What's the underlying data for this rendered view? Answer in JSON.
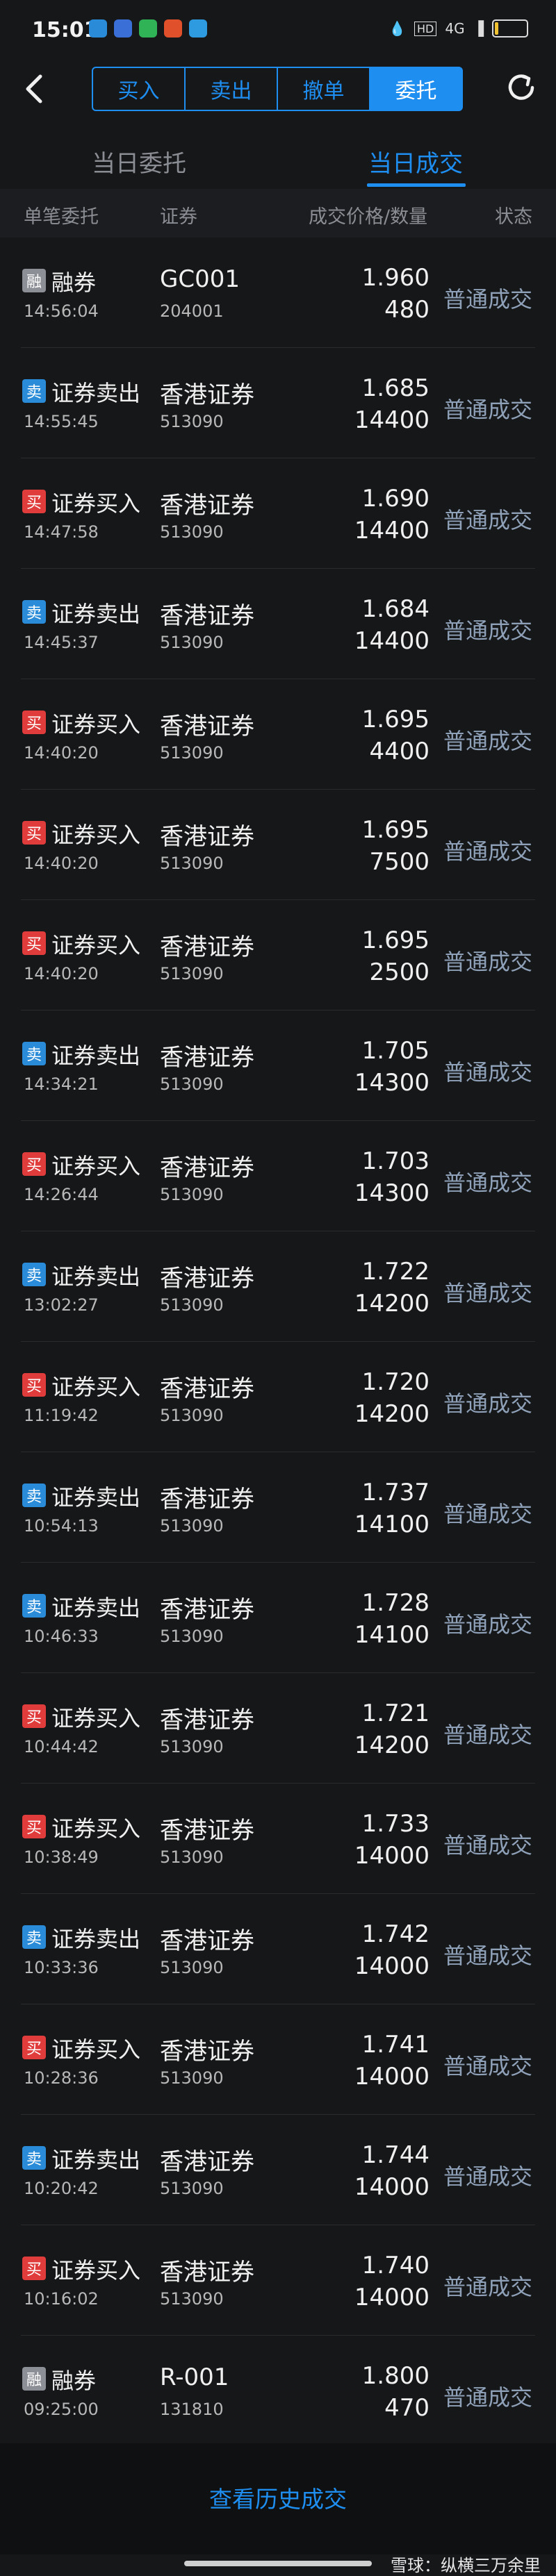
{
  "status_bar": {
    "time": "15:01",
    "network": "4G",
    "icons": [
      "phone-app-icon",
      "translate-app-icon",
      "wechat-app-icon",
      "weibo-app-icon",
      "telegram-app-icon"
    ],
    "right_icons": [
      "water-drop-icon",
      "hd-icon",
      "signal-icon"
    ],
    "battery_level": 0.12
  },
  "nav": {
    "tabs": [
      "买入",
      "卖出",
      "撤单",
      "委托"
    ],
    "active_tab": 3
  },
  "subtabs": {
    "left": "当日委托",
    "right": "当日成交"
  },
  "columns": {
    "c1": "单笔委托",
    "c2": "证券",
    "c3": "成交价格/数量",
    "c4": "状态"
  },
  "rows": [
    {
      "type": "loan",
      "badge": "融",
      "op": "融券",
      "time": "14:56:04",
      "name": "GC001",
      "code": "204001",
      "price": "1.960",
      "qty": "480",
      "state": "普通成交"
    },
    {
      "type": "sell",
      "badge": "卖",
      "op": "证券卖出",
      "time": "14:55:45",
      "name": "香港证券",
      "code": "513090",
      "price": "1.685",
      "qty": "14400",
      "state": "普通成交"
    },
    {
      "type": "buy",
      "badge": "买",
      "op": "证券买入",
      "time": "14:47:58",
      "name": "香港证券",
      "code": "513090",
      "price": "1.690",
      "qty": "14400",
      "state": "普通成交"
    },
    {
      "type": "sell",
      "badge": "卖",
      "op": "证券卖出",
      "time": "14:45:37",
      "name": "香港证券",
      "code": "513090",
      "price": "1.684",
      "qty": "14400",
      "state": "普通成交"
    },
    {
      "type": "buy",
      "badge": "买",
      "op": "证券买入",
      "time": "14:40:20",
      "name": "香港证券",
      "code": "513090",
      "price": "1.695",
      "qty": "4400",
      "state": "普通成交"
    },
    {
      "type": "buy",
      "badge": "买",
      "op": "证券买入",
      "time": "14:40:20",
      "name": "香港证券",
      "code": "513090",
      "price": "1.695",
      "qty": "7500",
      "state": "普通成交"
    },
    {
      "type": "buy",
      "badge": "买",
      "op": "证券买入",
      "time": "14:40:20",
      "name": "香港证券",
      "code": "513090",
      "price": "1.695",
      "qty": "2500",
      "state": "普通成交"
    },
    {
      "type": "sell",
      "badge": "卖",
      "op": "证券卖出",
      "time": "14:34:21",
      "name": "香港证券",
      "code": "513090",
      "price": "1.705",
      "qty": "14300",
      "state": "普通成交"
    },
    {
      "type": "buy",
      "badge": "买",
      "op": "证券买入",
      "time": "14:26:44",
      "name": "香港证券",
      "code": "513090",
      "price": "1.703",
      "qty": "14300",
      "state": "普通成交"
    },
    {
      "type": "sell",
      "badge": "卖",
      "op": "证券卖出",
      "time": "13:02:27",
      "name": "香港证券",
      "code": "513090",
      "price": "1.722",
      "qty": "14200",
      "state": "普通成交"
    },
    {
      "type": "buy",
      "badge": "买",
      "op": "证券买入",
      "time": "11:19:42",
      "name": "香港证券",
      "code": "513090",
      "price": "1.720",
      "qty": "14200",
      "state": "普通成交"
    },
    {
      "type": "sell",
      "badge": "卖",
      "op": "证券卖出",
      "time": "10:54:13",
      "name": "香港证券",
      "code": "513090",
      "price": "1.737",
      "qty": "14100",
      "state": "普通成交"
    },
    {
      "type": "sell",
      "badge": "卖",
      "op": "证券卖出",
      "time": "10:46:33",
      "name": "香港证券",
      "code": "513090",
      "price": "1.728",
      "qty": "14100",
      "state": "普通成交"
    },
    {
      "type": "buy",
      "badge": "买",
      "op": "证券买入",
      "time": "10:44:42",
      "name": "香港证券",
      "code": "513090",
      "price": "1.721",
      "qty": "14200",
      "state": "普通成交"
    },
    {
      "type": "buy",
      "badge": "买",
      "op": "证券买入",
      "time": "10:38:49",
      "name": "香港证券",
      "code": "513090",
      "price": "1.733",
      "qty": "14000",
      "state": "普通成交"
    },
    {
      "type": "sell",
      "badge": "卖",
      "op": "证券卖出",
      "time": "10:33:36",
      "name": "香港证券",
      "code": "513090",
      "price": "1.742",
      "qty": "14000",
      "state": "普通成交"
    },
    {
      "type": "buy",
      "badge": "买",
      "op": "证券买入",
      "time": "10:28:36",
      "name": "香港证券",
      "code": "513090",
      "price": "1.741",
      "qty": "14000",
      "state": "普通成交"
    },
    {
      "type": "sell",
      "badge": "卖",
      "op": "证券卖出",
      "time": "10:20:42",
      "name": "香港证券",
      "code": "513090",
      "price": "1.744",
      "qty": "14000",
      "state": "普通成交"
    },
    {
      "type": "buy",
      "badge": "买",
      "op": "证券买入",
      "time": "10:16:02",
      "name": "香港证券",
      "code": "513090",
      "price": "1.740",
      "qty": "14000",
      "state": "普通成交"
    },
    {
      "type": "loan",
      "badge": "融",
      "op": "融券",
      "time": "09:25:00",
      "name": "R-001",
      "code": "131810",
      "price": "1.800",
      "qty": "470",
      "state": "普通成交"
    }
  ],
  "footer": {
    "history_link": "查看历史成交"
  },
  "watermark": "雪球：纵横三万余里"
}
